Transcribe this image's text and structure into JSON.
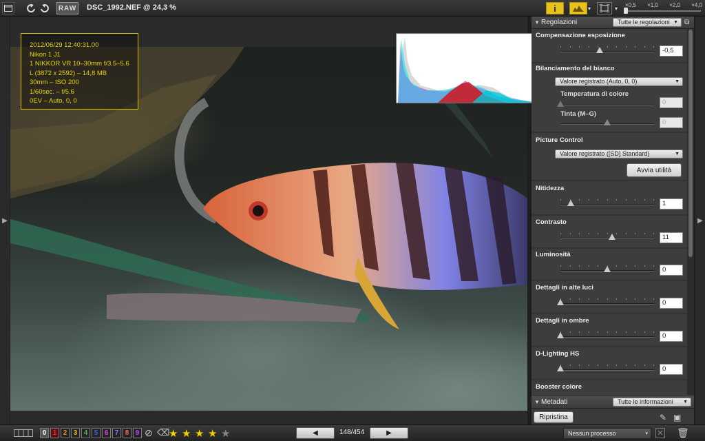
{
  "titlebar": {
    "filename": "DSC_1992.NEF @ 24,3 %",
    "raw_label": "RAW",
    "info_label": "i",
    "zoom_ticks": [
      "×0,5",
      "×1,0",
      "×2,0",
      "×4,0"
    ]
  },
  "exif": {
    "lines": [
      "2012/06/29 12:40:31.00",
      "Nikon 1 J1",
      "1 NIKKOR VR 10–30mm f/3.5–5.6",
      "L (3872 x 2592) – 14,8 MB",
      "30mm – ISO 200",
      "1/60sec. – f/5.6",
      "0EV – Auto, 0, 0"
    ]
  },
  "panel": {
    "header_title": "Regolazioni",
    "header_filter": "Tutte le regolazioni",
    "exposure": {
      "title": "Compensazione esposizione",
      "value": "-0,5",
      "level": 0.42
    },
    "white_balance": {
      "title": "Bilanciamento del bianco",
      "mode": "Valore registrato (Auto, 0, 0)",
      "temp_label": "Temperatura di colore",
      "temp_value": "0",
      "tint_label": "Tinta (M–G)",
      "tint_value": "0",
      "tint_level": 0.5
    },
    "picture_control": {
      "title": "Picture Control",
      "mode": "Valore registrato ([SD] Standard)",
      "launch_button": "Avvia utilità"
    },
    "sharpness": {
      "title": "Nitidezza",
      "value": "1",
      "level": 0.11
    },
    "contrast": {
      "title": "Contrasto",
      "value": "11",
      "level": 0.55
    },
    "brightness": {
      "title": "Luminosità",
      "value": "0",
      "level": 0.5
    },
    "highlights": {
      "title": "Dettagli in alte luci",
      "value": "0",
      "level": 0
    },
    "shadows": {
      "title": "Dettagli in ombre",
      "value": "0",
      "level": 0
    },
    "dlighting": {
      "title": "D-Lighting HS",
      "value": "0",
      "level": 0
    },
    "booster": {
      "title": "Booster colore"
    },
    "metadata_title": "Metadati",
    "metadata_filter": "Tutte le informazioni",
    "reset_button": "Ripristina"
  },
  "bottombar": {
    "labels": [
      "0",
      "1",
      "2",
      "3",
      "4",
      "5",
      "6",
      "7",
      "8",
      "9"
    ],
    "label_colors": [
      "#ffffff",
      "#e03030",
      "#f08a20",
      "#e0c020",
      "#50c050",
      "#4060e0",
      "#e040e0",
      "#a070ff",
      "#ff6060",
      "#c040ff"
    ],
    "rating": 4,
    "rating_max": 5,
    "counter": "148/454",
    "process": "Nessun processo"
  }
}
